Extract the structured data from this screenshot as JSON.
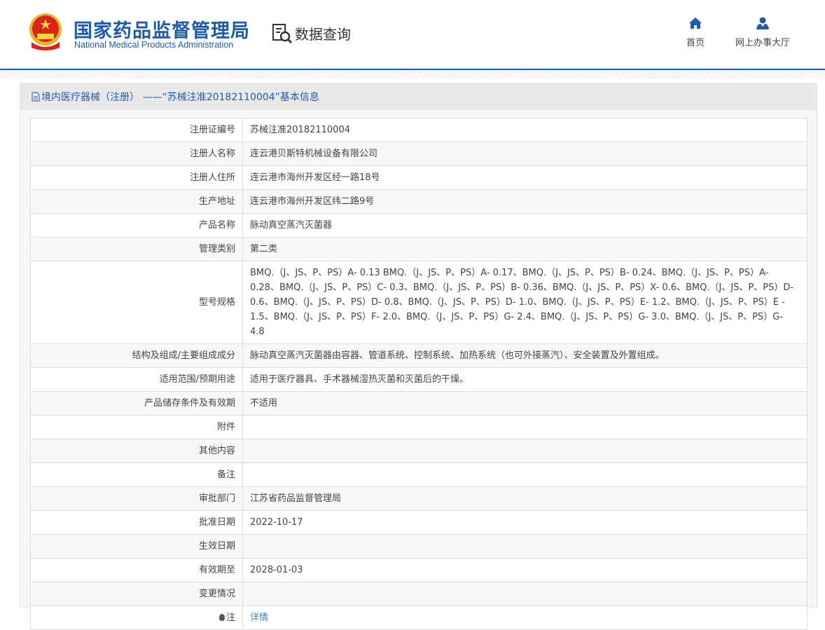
{
  "header": {
    "logo_cn": "国家药品监督管理局",
    "logo_en": "National Medical Products Administration",
    "section": "数据查询",
    "nav": [
      {
        "label": "首页"
      },
      {
        "label": "网上办事大厅"
      }
    ]
  },
  "panel": {
    "title": "境内医疗器械（注册） ——“苏械注准20182110004”基本信息"
  },
  "rows": [
    {
      "label": "注册证编号",
      "value": "苏械注准20182110004"
    },
    {
      "label": "注册人名称",
      "value": "连云港贝斯特机械设备有限公司"
    },
    {
      "label": "注册人住所",
      "value": "连云港市海州开发区经一路18号"
    },
    {
      "label": "生产地址",
      "value": "连云港市海州开发区纬二路9号"
    },
    {
      "label": "产品名称",
      "value": "脉动真空蒸汽灭菌器"
    },
    {
      "label": "管理类别",
      "value": "第二类"
    },
    {
      "label": "型号规格",
      "value": "BMQ.（J、JS、P、PS）A- 0.13 BMQ.（J、JS、P、PS）A- 0.17、BMQ.（J、JS、P、PS）B- 0.24、BMQ.（J、JS、P、PS）A- 0.28、BMQ.（J、JS、P、PS）C- 0.3、BMQ.（J、JS、P、PS）B- 0.36、BMQ.（J、JS、P、PS）X- 0.6、BMQ.（J、JS、P、PS）D- 0.6、BMQ.（J、JS、P、PS）D- 0.8、BMQ.（J、JS、P、PS）D- 1.0、BMQ.（J、JS、P、PS）E- 1.2、BMQ.（J、JS、P、PS）E - 1.5、BMQ.（J、JS、P、PS）F- 2.0、BMQ.（J、JS、P、PS）G- 2.4、BMQ.（J、JS、P、PS）G- 3.0、BMQ.（J、JS、P、PS）G- 4.8"
    },
    {
      "label": "结构及组成/主要组成成分",
      "value": "脉动真空蒸汽灭菌器由容器、管道系统、控制系统、加热系统（也可外接蒸汽）、安全装置及外置组成。"
    },
    {
      "label": "适用范围/预期用途",
      "value": "适用于医疗器具、手术器械湿热灭菌和灭菌后的干燥。"
    },
    {
      "label": "产品储存条件及有效期",
      "value": "不适用"
    },
    {
      "label": "附件",
      "value": ""
    },
    {
      "label": "其他内容",
      "value": ""
    },
    {
      "label": "备注",
      "value": ""
    },
    {
      "label": "审批部门",
      "value": "江苏省药品监督管理局"
    },
    {
      "label": "批准日期",
      "value": "2022-10-17"
    },
    {
      "label": "生效日期",
      "value": ""
    },
    {
      "label": "有效期至",
      "value": "2028-01-03"
    },
    {
      "label": "变更情况",
      "value": ""
    }
  ],
  "note": {
    "label": "注",
    "link": "详情"
  }
}
